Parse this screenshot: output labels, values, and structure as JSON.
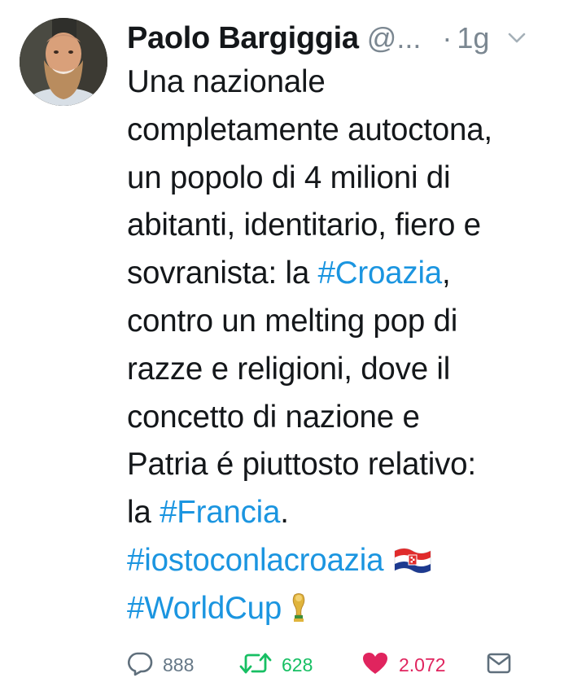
{
  "tweet": {
    "author": {
      "display_name": "Paolo Bargiggia",
      "handle": "@...",
      "avatar": "bearded-man-avatar"
    },
    "separator": "·",
    "timestamp": "1g",
    "menu_icon": "chevron-down-icon",
    "body_lines": [
      [
        {
          "t": "Una nazionale"
        }
      ],
      [
        {
          "t": "completamente autoctona,"
        }
      ],
      [
        {
          "t": "un popolo di 4 milioni di"
        }
      ],
      [
        {
          "t": "abitanti, identitario, fiero e"
        }
      ],
      [
        {
          "t": "sovranista:  la "
        },
        {
          "t": "#Croazia",
          "tag": true
        },
        {
          "t": ","
        }
      ],
      [
        {
          "t": "contro un melting pop di"
        }
      ],
      [
        {
          "t": "razze e religioni, dove il"
        }
      ],
      [
        {
          "t": "concetto di nazione e"
        }
      ],
      [
        {
          "t": "Patria é  piuttosto relativo:"
        }
      ],
      [
        {
          "t": "la "
        },
        {
          "t": "#Francia",
          "tag": true
        },
        {
          "t": "."
        }
      ],
      [
        {
          "t": "#iostoconlacroazia",
          "tag": true
        },
        {
          "emoji": "croatia-flag"
        }
      ],
      [
        {
          "t": "#WorldCup",
          "tag": true
        },
        {
          "emoji": "trophy"
        }
      ]
    ],
    "actions": {
      "reply": {
        "icon": "reply-icon",
        "count": "888"
      },
      "retweet": {
        "icon": "retweet-icon",
        "count": "628"
      },
      "like": {
        "icon": "heart-icon",
        "count": "2.072"
      },
      "dm": {
        "icon": "envelope-icon"
      }
    },
    "colors": {
      "hashtag": "#1b95e0",
      "text": "#14171a",
      "muted": "#7b8791",
      "retweet": "#17bf63",
      "like": "#e0245e"
    }
  }
}
